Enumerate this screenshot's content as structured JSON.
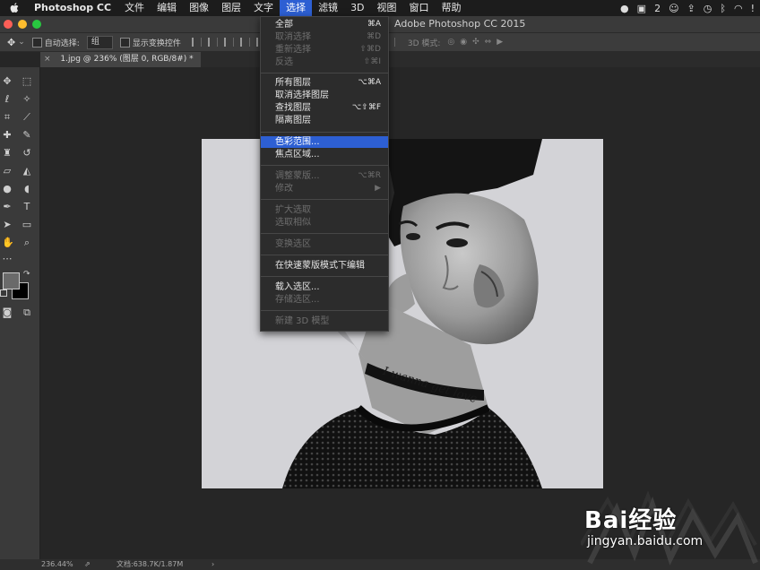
{
  "menubar": {
    "items": [
      "Photoshop CC",
      "文件",
      "编辑",
      "图像",
      "图层",
      "文字",
      "选择",
      "滤镜",
      "3D",
      "视图",
      "窗口",
      "帮助"
    ],
    "active_index": 6,
    "status_count": "2"
  },
  "window": {
    "title": "Adobe Photoshop CC 2015"
  },
  "options_bar": {
    "auto_select_label": "自动选择:",
    "auto_select_value": "组",
    "show_transform_label": "显示变换控件",
    "mode_3d_label": "3D 模式:"
  },
  "document_tab": {
    "title": "1.jpg @ 236% (图层 0, RGB/8#) *"
  },
  "select_menu": {
    "items": [
      {
        "label": "全部",
        "shortcut": "⌘A",
        "enabled": true
      },
      {
        "label": "取消选择",
        "shortcut": "⌘D",
        "enabled": false
      },
      {
        "label": "重新选择",
        "shortcut": "⇧⌘D",
        "enabled": false
      },
      {
        "label": "反选",
        "shortcut": "⇧⌘I",
        "enabled": false
      },
      {
        "label": "所有图层",
        "shortcut": "⌥⌘A",
        "enabled": true
      },
      {
        "label": "取消选择图层",
        "shortcut": "",
        "enabled": true
      },
      {
        "label": "查找图层",
        "shortcut": "⌥⇧⌘F",
        "enabled": true
      },
      {
        "label": "隔离图层",
        "shortcut": "",
        "enabled": true
      },
      {
        "label": "色彩范围...",
        "shortcut": "",
        "enabled": true,
        "highlighted": true
      },
      {
        "label": "焦点区域...",
        "shortcut": "",
        "enabled": true
      },
      {
        "label": "调整蒙版...",
        "shortcut": "⌥⌘R",
        "enabled": false
      },
      {
        "label": "修改",
        "shortcut": "▶",
        "enabled": false
      },
      {
        "label": "扩大选取",
        "shortcut": "",
        "enabled": false
      },
      {
        "label": "选取相似",
        "shortcut": "",
        "enabled": false
      },
      {
        "label": "变换选区",
        "shortcut": "",
        "enabled": false
      },
      {
        "label": "在快速蒙版模式下编辑",
        "shortcut": "",
        "enabled": true
      },
      {
        "label": "载入选区...",
        "shortcut": "",
        "enabled": true
      },
      {
        "label": "存储选区...",
        "shortcut": "",
        "enabled": false
      },
      {
        "label": "新建 3D 模型",
        "shortcut": "",
        "enabled": false
      }
    ]
  },
  "canvas": {
    "tattoo_text": "I wanna get love"
  },
  "status_bar": {
    "zoom": "236.44%",
    "doc_size": "文档:638.7K/1.87M"
  },
  "watermark": {
    "brand": "Bai经验",
    "url": "jingyan.baidu.com"
  },
  "colors": {
    "accent": "#2d5fd3",
    "panel": "#3a3a3a",
    "workspace": "#262626"
  }
}
